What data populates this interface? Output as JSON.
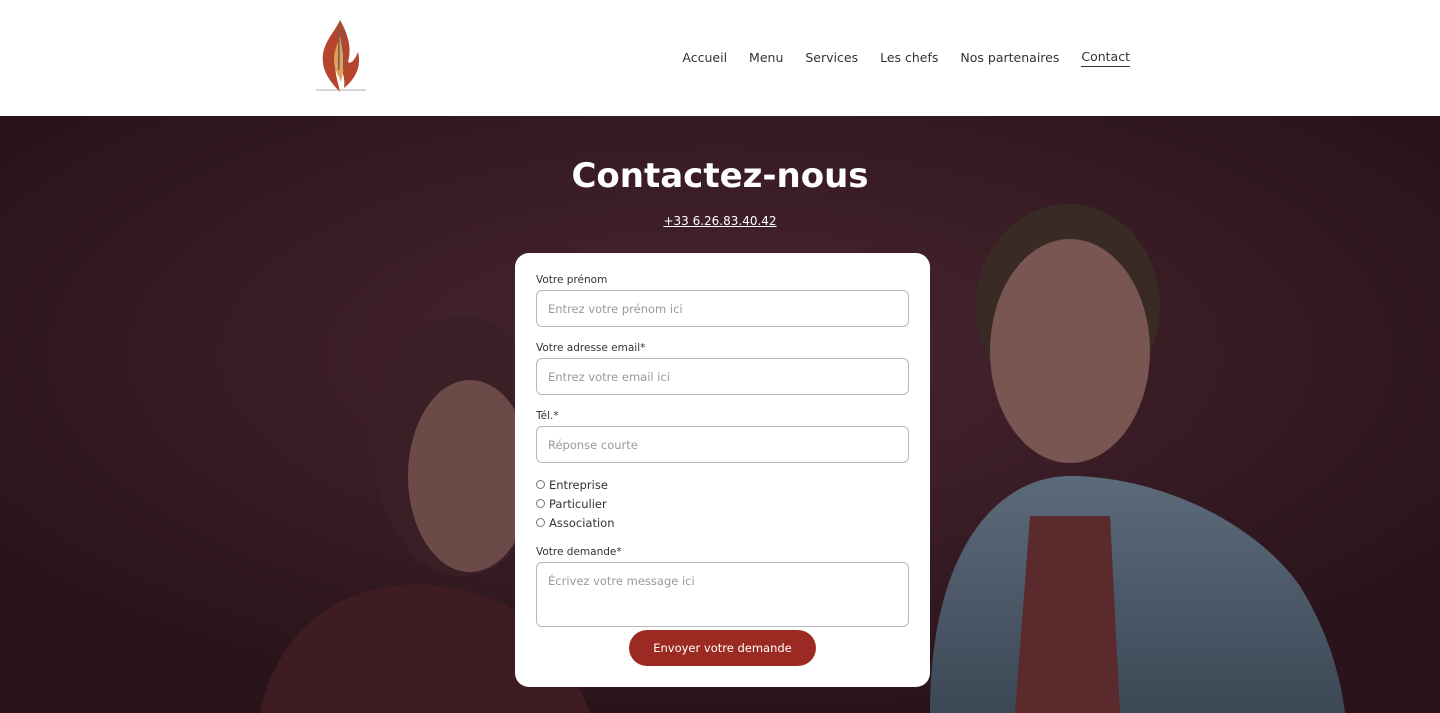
{
  "nav": {
    "items": [
      {
        "label": "Accueil"
      },
      {
        "label": "Menu"
      },
      {
        "label": "Services"
      },
      {
        "label": "Les chefs"
      },
      {
        "label": "Nos partenaires"
      },
      {
        "label": "Contact"
      }
    ],
    "active": "Contact"
  },
  "hero": {
    "title": "Contactez-nous",
    "phone": "+33 6.26.83.40.42"
  },
  "form": {
    "firstname": {
      "label": "Votre prénom",
      "placeholder": "Entrez votre prénom ici",
      "value": ""
    },
    "email": {
      "label": "Votre adresse email*",
      "placeholder": "Entrez votre email ici",
      "value": ""
    },
    "phone": {
      "label": "Tél.*",
      "placeholder": "Réponse courte",
      "value": ""
    },
    "options": [
      {
        "label": "Entreprise"
      },
      {
        "label": "Particulier"
      },
      {
        "label": "Association"
      }
    ],
    "request": {
      "label": "Votre demande*",
      "placeholder": "Écrivez votre message ici",
      "value": ""
    },
    "submit_label": "Envoyer votre demande"
  },
  "colors": {
    "accent": "#9b2b22",
    "hero_bg": "#2f1820"
  }
}
